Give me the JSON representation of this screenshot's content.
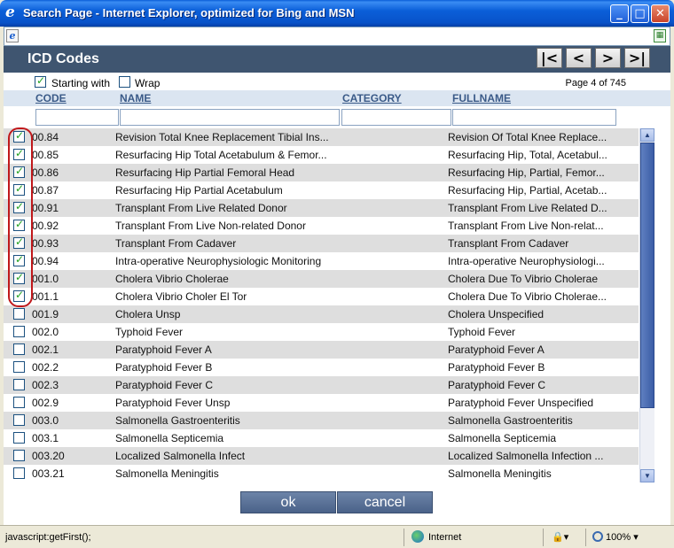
{
  "window": {
    "title": "Search Page - Internet Explorer, optimized for Bing and MSN",
    "minimize": "_",
    "maximize": "□",
    "close": "✕"
  },
  "header": {
    "title": "ICD Codes",
    "nav": {
      "first": "|<",
      "prev": "<",
      "next": ">",
      "last": ">|"
    }
  },
  "options": {
    "starting_with": {
      "label": "Starting with",
      "checked": true
    },
    "wrap": {
      "label": "Wrap",
      "checked": false
    },
    "page_info": "Page 4 of 745"
  },
  "columns": [
    "CODE",
    "NAME",
    "CATEGORY",
    "FULLNAME"
  ],
  "filters": {
    "code": "",
    "name": "",
    "category": "",
    "fullname": ""
  },
  "rows": [
    {
      "checked": true,
      "code": "00.84",
      "name": "Revision Total Knee Replacement Tibial Ins...",
      "full": "Revision Of Total Knee Replace..."
    },
    {
      "checked": true,
      "code": "00.85",
      "name": "Resurfacing Hip Total Acetabulum & Femor...",
      "full": "Resurfacing Hip, Total, Acetabul..."
    },
    {
      "checked": true,
      "code": "00.86",
      "name": "Resurfacing Hip Partial Femoral Head",
      "full": "Resurfacing Hip, Partial, Femor..."
    },
    {
      "checked": true,
      "code": "00.87",
      "name": "Resurfacing Hip Partial Acetabulum",
      "full": "Resurfacing Hip, Partial, Acetab..."
    },
    {
      "checked": true,
      "code": "00.91",
      "name": "Transplant From Live Related Donor",
      "full": "Transplant From Live Related D..."
    },
    {
      "checked": true,
      "code": "00.92",
      "name": "Transplant From Live Non-related Donor",
      "full": "Transplant From Live Non-relat..."
    },
    {
      "checked": true,
      "code": "00.93",
      "name": "Transplant From Cadaver",
      "full": "Transplant From Cadaver"
    },
    {
      "checked": true,
      "code": "00.94",
      "name": "Intra-operative Neurophysiologic Monitoring",
      "full": "Intra-operative Neurophysiologi..."
    },
    {
      "checked": true,
      "code": "001.0",
      "name": "Cholera Vibrio Cholerae",
      "full": "Cholera Due To Vibrio Cholerae"
    },
    {
      "checked": true,
      "code": "001.1",
      "name": "Cholera Vibrio Choler El Tor",
      "full": "Cholera Due To Vibrio Cholerae..."
    },
    {
      "checked": false,
      "code": "001.9",
      "name": "Cholera Unsp",
      "full": "Cholera Unspecified"
    },
    {
      "checked": false,
      "code": "002.0",
      "name": "Typhoid Fever",
      "full": "Typhoid Fever"
    },
    {
      "checked": false,
      "code": "002.1",
      "name": "Paratyphoid Fever A",
      "full": "Paratyphoid Fever A"
    },
    {
      "checked": false,
      "code": "002.2",
      "name": "Paratyphoid Fever B",
      "full": "Paratyphoid Fever B"
    },
    {
      "checked": false,
      "code": "002.3",
      "name": "Paratyphoid Fever C",
      "full": "Paratyphoid Fever C"
    },
    {
      "checked": false,
      "code": "002.9",
      "name": "Paratyphoid Fever Unsp",
      "full": "Paratyphoid Fever Unspecified"
    },
    {
      "checked": false,
      "code": "003.0",
      "name": "Salmonella Gastroenteritis",
      "full": "Salmonella Gastroenteritis"
    },
    {
      "checked": false,
      "code": "003.1",
      "name": "Salmonella Septicemia",
      "full": "Salmonella Septicemia"
    },
    {
      "checked": false,
      "code": "003.20",
      "name": "Localized Salmonella Infect",
      "full": "Localized Salmonella Infection ..."
    },
    {
      "checked": false,
      "code": "003.21",
      "name": "Salmonella Meningitis",
      "full": "Salmonella Meningitis"
    }
  ],
  "buttons": {
    "ok": "ok",
    "cancel": "cancel"
  },
  "status": {
    "text": "javascript:getFirst();",
    "zone": "Internet",
    "zoom": "100%"
  },
  "colors": {
    "header_bg": "#3f5570",
    "row_alt": "#dedede",
    "highlight": "#c0181b"
  },
  "icons": [
    "ie-icon",
    "page-icon",
    "compat-view-icon",
    "globe-icon",
    "security-icon",
    "zoom-icon"
  ]
}
